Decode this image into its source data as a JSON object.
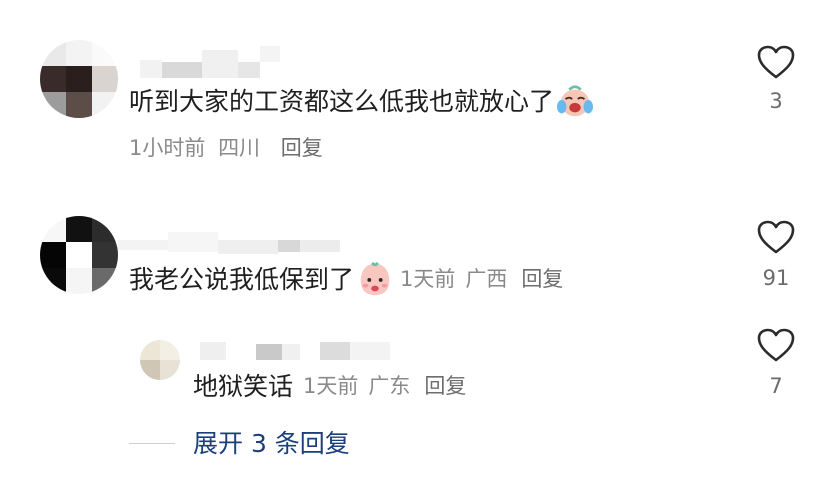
{
  "comments": [
    {
      "text": "听到大家的工资都这么低我也就放心了",
      "emoji_icon": "crying-laughing-face-icon",
      "time": "1小时前",
      "location": "四川",
      "reply_label": "回复",
      "likes": "3"
    },
    {
      "text": "我老公说我低保到了",
      "emoji_icon": "pink-face-icon",
      "time": "1天前",
      "location": "广西",
      "reply_label": "回复",
      "likes": "91"
    }
  ],
  "sub_reply": {
    "text": "地狱笑话",
    "time": "1天前",
    "location": "广东",
    "reply_label": "回复",
    "likes": "7"
  },
  "expand": {
    "label": "展开 3 条回复"
  },
  "colors": {
    "text": "#1f1f1f",
    "meta": "#8a8a8a",
    "expand_link": "#1b3f7a",
    "heart_stroke": "#2b2b2b"
  }
}
